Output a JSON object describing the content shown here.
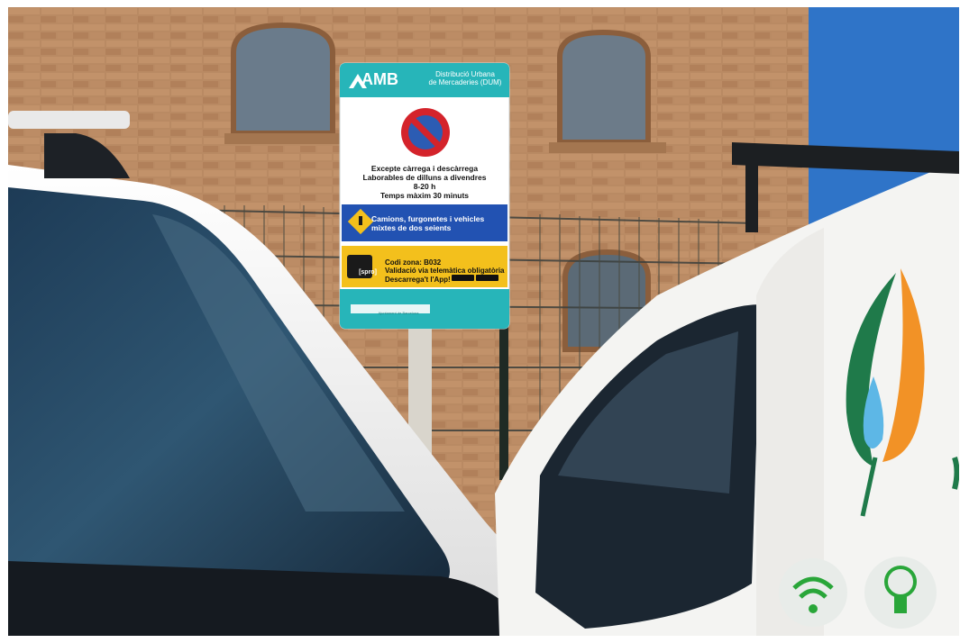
{
  "photo": {
    "sign": {
      "header_logo": "AMB",
      "header_title_1": "Distribució Urbana",
      "header_title_2": "de Mercaderies (DUM)",
      "rules_1": "Excepte càrrega i descàrrega",
      "rules_2": "Laborables de dilluns a divendres",
      "rules_3": "8-20 h",
      "rules_4": "Temps màxim 30 minuts",
      "vehicles_1": "Camions, furgonetes i vehicles",
      "vehicles_2": "mixtes de dos seients",
      "app_logo": "[spro]",
      "zone_1": "Codi zona: B032",
      "zone_2": "Validació via telemàtica obligatòria",
      "zone_3": "Descarrega't l'App!",
      "footer_text": "Ajuntament de Barcelona"
    },
    "colors": {
      "brick": "#b98a63",
      "sky": "#2f74c8",
      "sign_teal": "#27b5b9",
      "sign_blue": "#2252b2",
      "sign_yellow": "#f3c01c",
      "van_white": "#f4f4f2",
      "leaf_green": "#1f7a4a",
      "leaf_orange": "#f29226",
      "leaf_blue": "#5db7e6"
    },
    "icons": [
      "no-parking-icon",
      "warning-sign-icon",
      "wifi-icon",
      "lightbulb-icon"
    ]
  }
}
